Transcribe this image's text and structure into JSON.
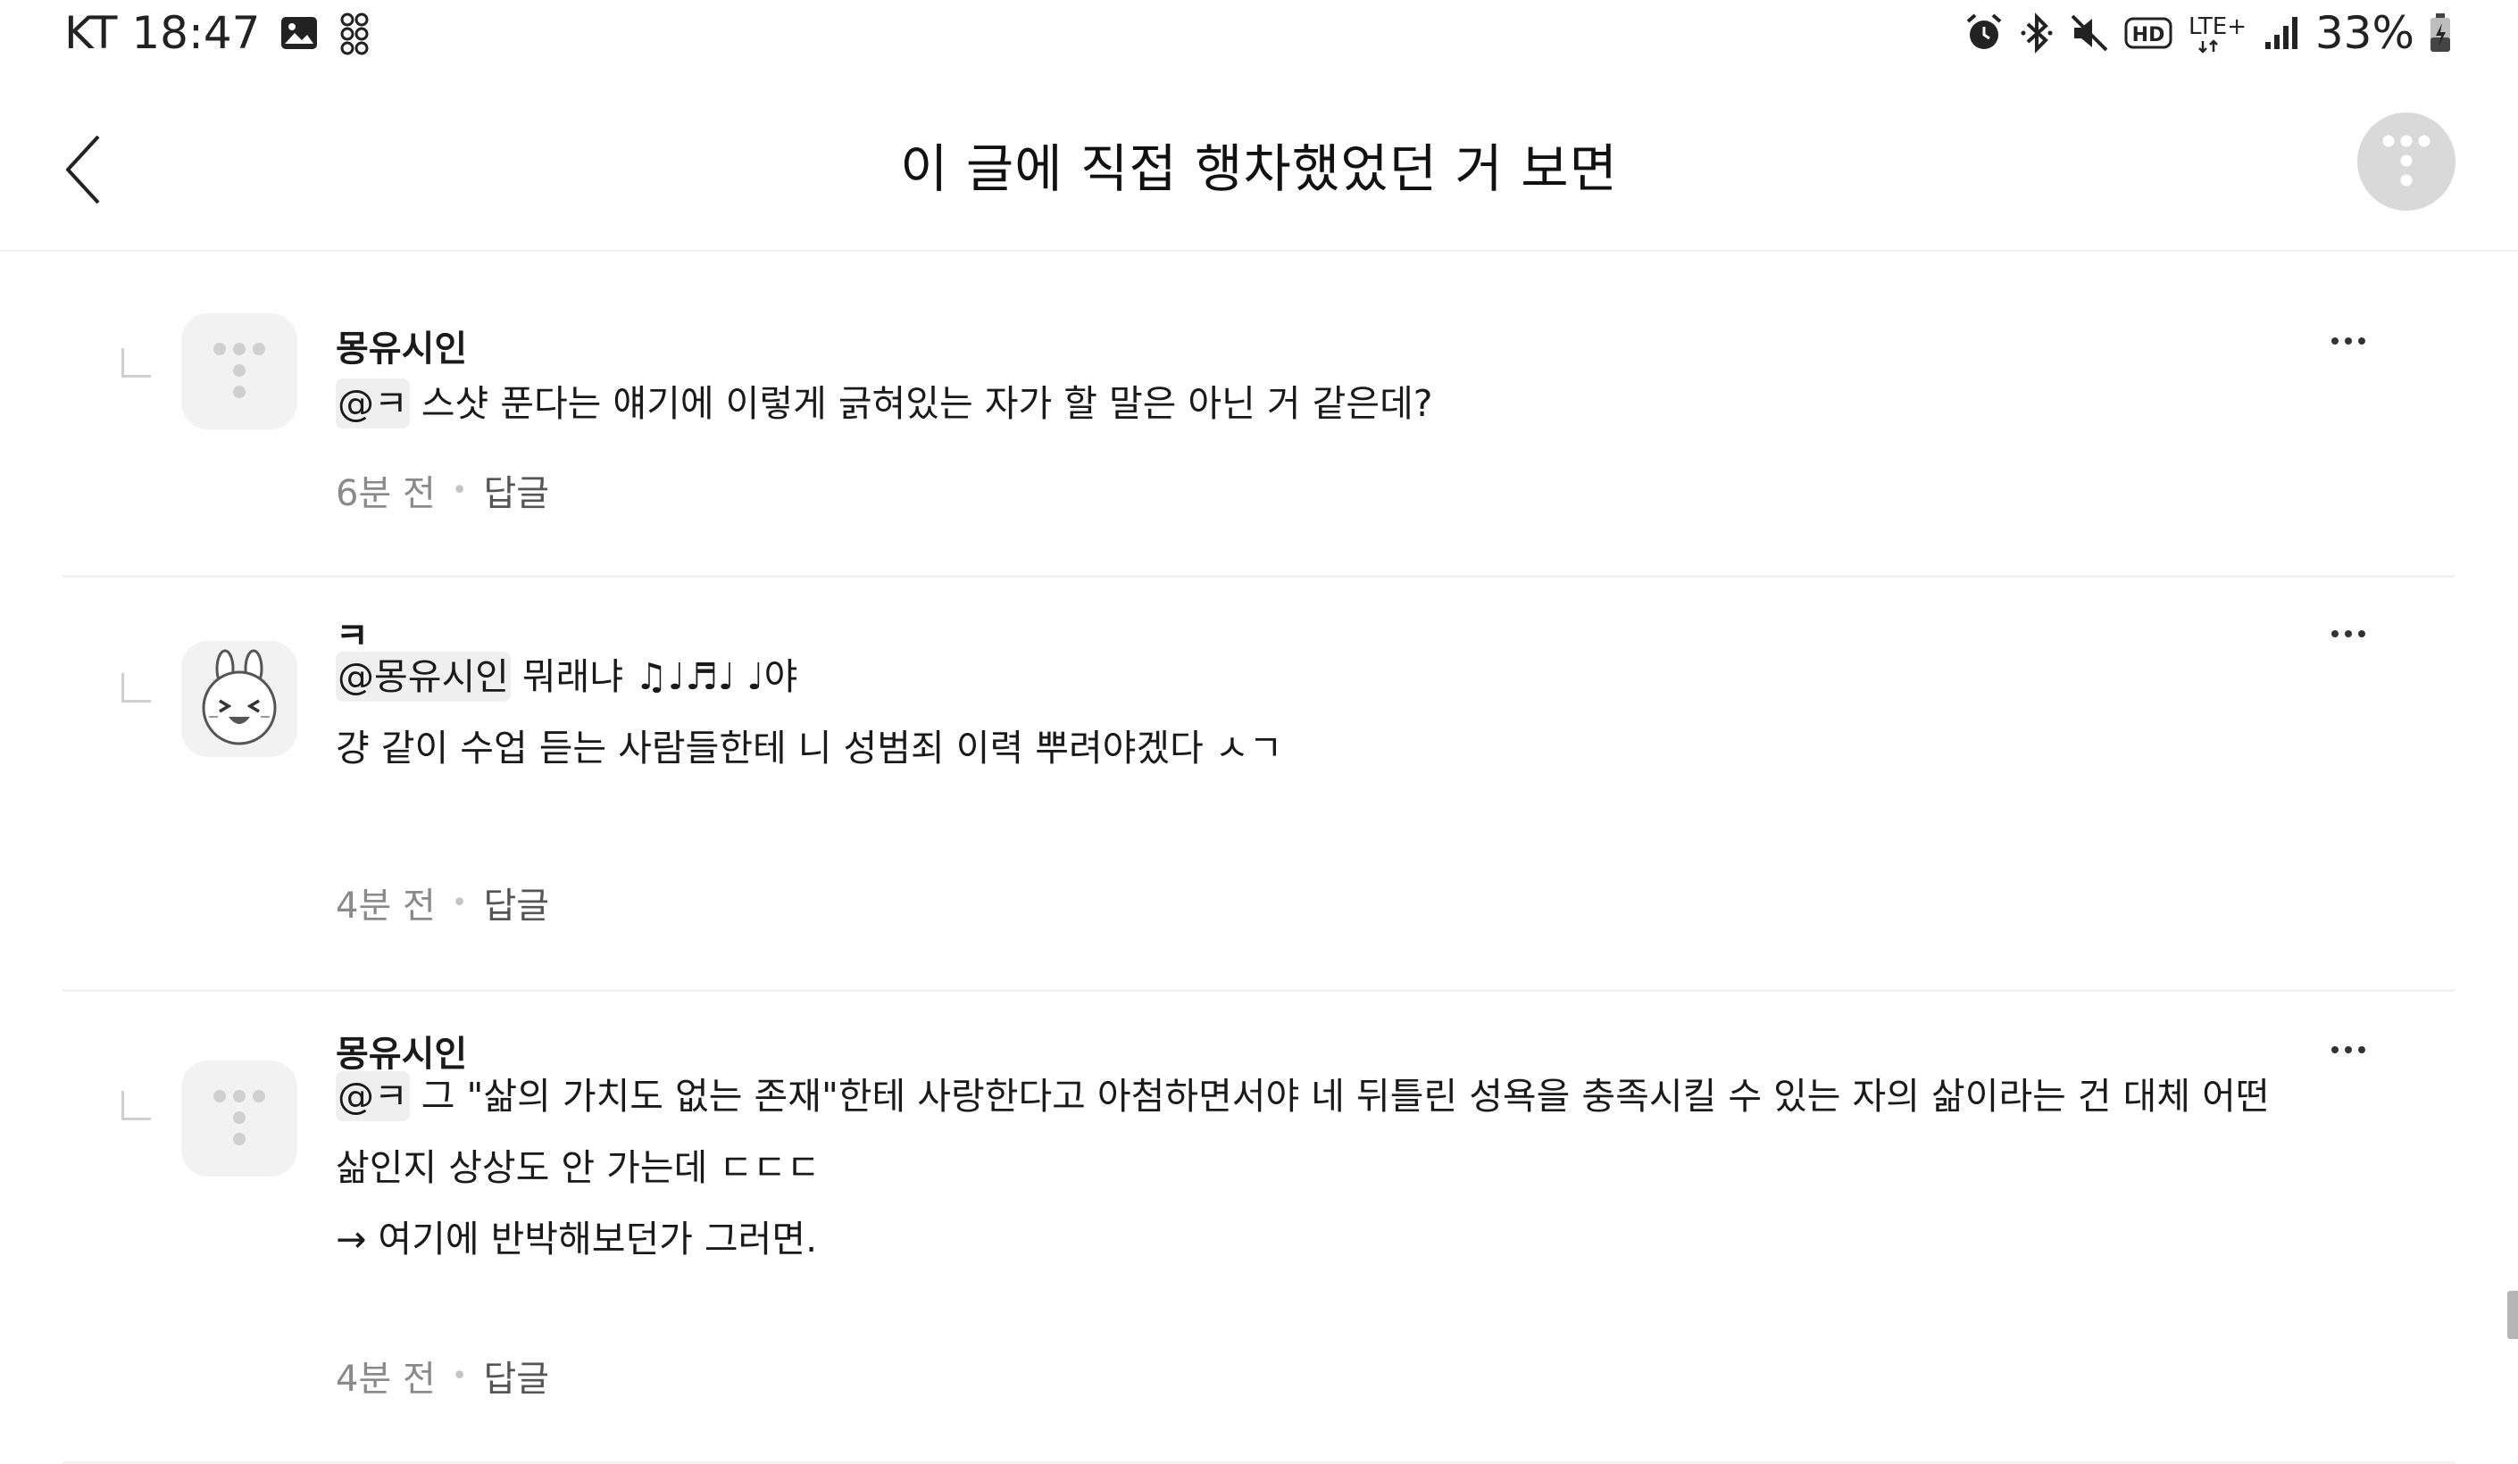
{
  "status_bar": {
    "carrier": "KT",
    "time": "18:47",
    "network": "LTE+",
    "battery": "33%",
    "icons": [
      "gallery-icon",
      "app-grid-icon",
      "alarm-icon",
      "bluetooth-icon",
      "mute-icon",
      "hd-voice-icon",
      "lte-icon",
      "signal-icon",
      "battery-icon"
    ]
  },
  "header": {
    "title": "이 글에 직접 행차했었던 거 보면",
    "back_icon": "chevron-left-icon",
    "logo_icon": "everytime-logo-icon"
  },
  "comments": [
    {
      "author": "몽유시인",
      "avatar": "default-logo-avatar",
      "lines": [
        {
          "mention": "@ㅋ",
          "text": " 스샷 푼다는 얘기에 이렇게 긁혀있는 자가 할 말은 아닌 거 같은데?"
        }
      ],
      "time": "6분 전",
      "reply_label": "답글"
    },
    {
      "author": "ㅋ",
      "avatar": "bunny-avatar",
      "lines": [
        {
          "mention": "@몽유시인",
          "text": " 뭐래냐 ♫♩♬♩ ♩야"
        },
        {
          "mention": "",
          "text": "걍 같이 수업 듣는 사람들한테 니 성범죄 이력 뿌려야겠다 ㅅㄱ"
        }
      ],
      "time": "4분 전",
      "reply_label": "답글"
    },
    {
      "author": "몽유시인",
      "avatar": "default-logo-avatar",
      "lines": [
        {
          "mention": "@ㅋ",
          "text": " 그 \"삶의 가치도 없는 존재\"한테 사랑한다고 아첨하면서야 네 뒤틀린 성욕을 충족시킬 수 있는 자의 삶이라는 건 대체 어떤"
        },
        {
          "mention": "",
          "text": "삶인지 상상도 안 가는데 ㄷㄷㄷ"
        },
        {
          "mention": "",
          "text": "→ 여기에 반박해보던가 그러면."
        }
      ],
      "time": "4분 전",
      "reply_label": "답글"
    }
  ],
  "colors": {
    "text": "#1a1a1a",
    "muted": "#8a8a8a",
    "divider": "#f2f2f2",
    "avatar_bg": "#f2f2f2"
  }
}
